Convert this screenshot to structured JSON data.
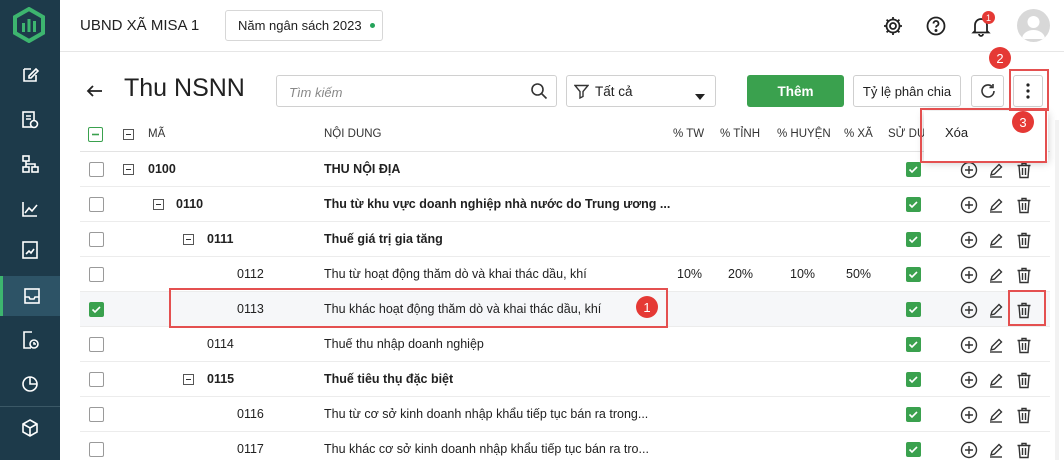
{
  "topbar": {
    "org": "UBND XÃ MISA 1",
    "budget_year": "Năm ngân sách 2023",
    "notification_count": "1"
  },
  "page": {
    "title": "Thu NSNN"
  },
  "toolbar": {
    "search_placeholder": "Tìm kiếm",
    "filter_value": "Tất cả",
    "add_label": "Thêm",
    "ratio_label": "Tỷ lệ phân chia"
  },
  "more_menu": {
    "delete_label": "Xóa"
  },
  "columns": {
    "code": "MÃ",
    "content": "NỘI DUNG",
    "tw": "% TW",
    "tinh": "% TỈNH",
    "huyen": "% HUYỆN",
    "xa": "% XÃ",
    "sd": "SỬ DỤ"
  },
  "markers": {
    "m1": "1",
    "m2": "2",
    "m3": "3"
  },
  "rows": [
    {
      "code": "0100",
      "content": "THU NỘI ĐỊA",
      "tw": "",
      "tinh": "",
      "huyen": "",
      "xa": ""
    },
    {
      "code": "0110",
      "content": "Thu từ khu vực doanh nghiệp nhà nước do Trung ương ...",
      "tw": "",
      "tinh": "",
      "huyen": "",
      "xa": ""
    },
    {
      "code": "0111",
      "content": "Thuế giá trị gia tăng",
      "tw": "",
      "tinh": "",
      "huyen": "",
      "xa": ""
    },
    {
      "code": "0112",
      "content": "Thu từ hoạt động thăm dò và khai thác dầu, khí",
      "tw": "10%",
      "tinh": "20%",
      "huyen": "10%",
      "xa": "50%"
    },
    {
      "code": "0113",
      "content": "Thu khác hoạt động thăm dò và khai thác dầu, khí",
      "tw": "",
      "tinh": "",
      "huyen": "",
      "xa": ""
    },
    {
      "code": "0114",
      "content": "Thuế thu nhập doanh nghiệp",
      "tw": "",
      "tinh": "",
      "huyen": "",
      "xa": ""
    },
    {
      "code": "0115",
      "content": "Thuế tiêu thụ đặc biệt",
      "tw": "",
      "tinh": "",
      "huyen": "",
      "xa": ""
    },
    {
      "code": "0116",
      "content": "Thu từ cơ sở kinh doanh nhập khẩu tiếp tục bán ra trong...",
      "tw": "",
      "tinh": "",
      "huyen": "",
      "xa": ""
    },
    {
      "code": "0117",
      "content": "Thu khác cơ sở kinh doanh nhập khẩu tiếp tục bán ra tro...",
      "tw": "",
      "tinh": "",
      "huyen": "",
      "xa": ""
    }
  ],
  "colors": {
    "sidebar": "#1d3a4a",
    "accent": "#3aa14e",
    "highlight": "#e45050",
    "marker": "#e53935"
  },
  "icons": {
    "logo": "misa-logo-icon",
    "settings": "gear-icon",
    "help": "help-icon",
    "notify": "bell-icon",
    "back": "arrow-left-icon",
    "search": "search-icon",
    "filter": "funnel-icon",
    "refresh": "refresh-icon",
    "more": "more-vertical-icon",
    "add": "plus-circle-icon",
    "edit": "pencil-icon",
    "delete": "trash-icon"
  }
}
